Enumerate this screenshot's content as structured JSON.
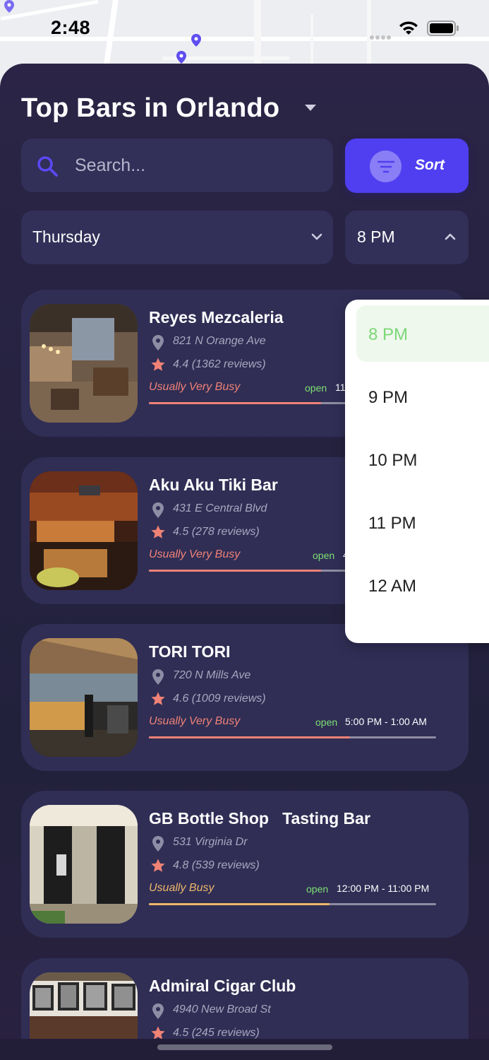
{
  "status": {
    "time": "2:48"
  },
  "header": {
    "title": "Top Bars in Orlando"
  },
  "search": {
    "placeholder": "Search...",
    "value": ""
  },
  "sort": {
    "label": "Sort"
  },
  "filters": {
    "day": "Thursday",
    "time": "8 PM"
  },
  "dropdown": {
    "options": [
      "8 PM",
      "9 PM",
      "10 PM",
      "11 PM",
      "12 AM"
    ],
    "selected": "8 PM"
  },
  "bars": [
    {
      "name": "Reyes Mezcaleria",
      "address": "821 N Orange Ave",
      "rating": "4.4 (1362 reviews)",
      "busyness": "Usually Very Busy",
      "open_label": "open",
      "hours": "11",
      "busy_fraction": 0.6,
      "busy_color": "#f08276"
    },
    {
      "name": "Aku Aku Tiki Bar",
      "address": "431 E Central Blvd",
      "rating": "4.5 (278 reviews)",
      "busyness": "Usually Very Busy",
      "open_label": "open",
      "hours": "4",
      "busy_fraction": 0.6,
      "busy_color": "#f08276"
    },
    {
      "name": "TORI TORI",
      "address": "720 N Mills Ave",
      "rating": "4.6 (1009 reviews)",
      "busyness": "Usually Very Busy",
      "open_label": "open",
      "hours": "5:00 PM - 1:00 AM",
      "busy_fraction": 0.7,
      "busy_color": "#f08276"
    },
    {
      "name": "GB Bottle Shop   Tasting Bar",
      "address": "531 Virginia Dr",
      "rating": "4.8 (539 reviews)",
      "busyness": "Usually Busy",
      "open_label": "open",
      "hours": "12:00 PM - 11:00 PM",
      "busy_fraction": 0.63,
      "busy_color": "#efb76a"
    },
    {
      "name": "Admiral Cigar Club",
      "address": "4940 New Broad St",
      "rating": "4.5 (245 reviews)"
    }
  ],
  "colors": {
    "accent": "#4f3ff0",
    "open": "#7ee073",
    "very_busy": "#f08276",
    "busy": "#efb76a",
    "selected_option": "#7dd67a"
  },
  "icons": [
    "search-icon",
    "filter-icon",
    "chevron-down-icon",
    "chevron-up-icon",
    "location-pin-icon",
    "star-icon",
    "wifi-icon",
    "battery-icon",
    "caret-down-icon"
  ]
}
